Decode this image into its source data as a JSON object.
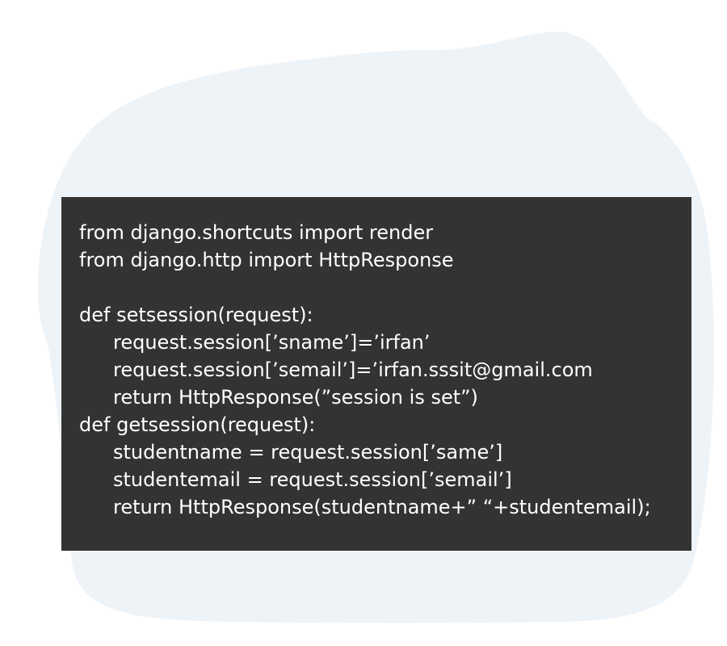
{
  "colors": {
    "background": "#ffffff",
    "blob": "#eef3f8",
    "panel": "#333333",
    "text": "#ffffff"
  },
  "code": {
    "lines": [
      "from django.shortcuts import render",
      "from django.http import HttpResponse",
      "",
      "def setsession(request):",
      "request.session[’sname’]=’irfan’",
      "request.session[’semail’]=’irfan.sssit@gmail.com",
      "return HttpResponse(”session is set”)",
      "def getsession(request):",
      "studentname = request.session[’same’]",
      "studentemail = request.session[’semail’]",
      "return HttpResponse(studentname+” “+studentemail);"
    ]
  }
}
